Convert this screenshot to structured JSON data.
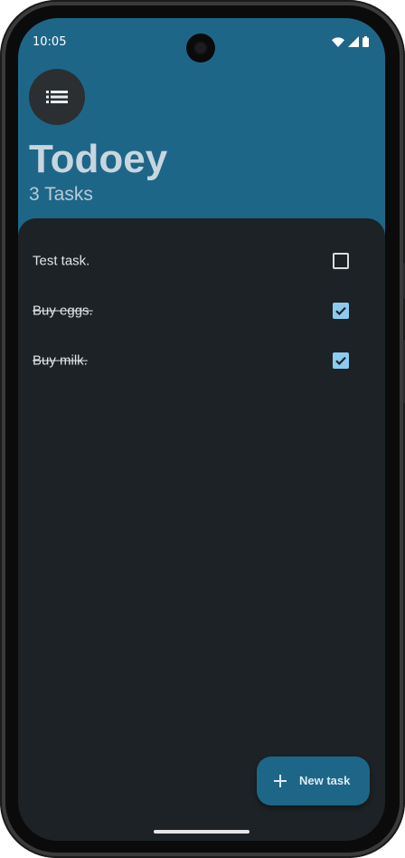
{
  "status_bar": {
    "time": "10:05",
    "icons": [
      "wifi-icon",
      "cellular-signal-icon",
      "battery-icon"
    ]
  },
  "header": {
    "menu_icon": "list-icon",
    "title": "Todoey",
    "subtitle": "3 Tasks"
  },
  "tasks": [
    {
      "label": "Test task.",
      "done": false
    },
    {
      "label": "Buy eggs.",
      "done": true
    },
    {
      "label": "Buy milk.",
      "done": true
    }
  ],
  "fab": {
    "icon": "plus-icon",
    "label": "New task"
  },
  "colors": {
    "header_bg": "#1e6688",
    "sheet_bg": "#1c2225",
    "checkbox_checked": "#8ccbf0",
    "fab_bg": "#1e6688"
  }
}
